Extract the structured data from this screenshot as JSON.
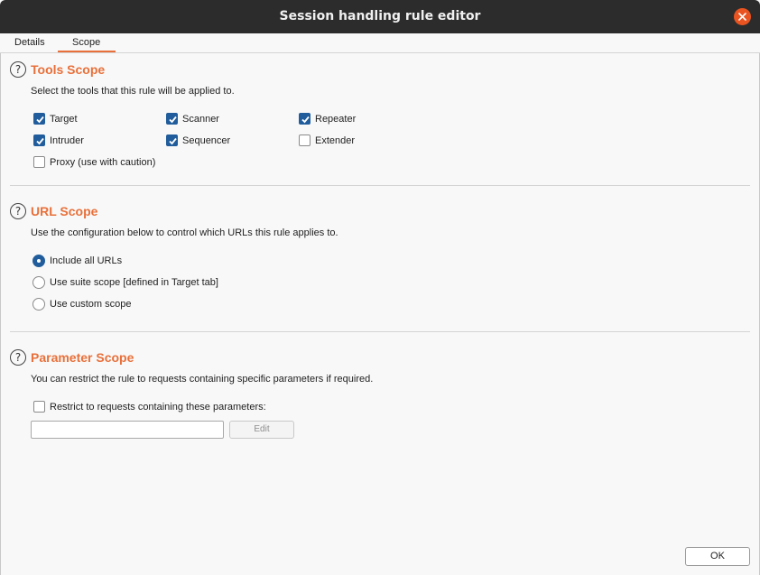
{
  "window": {
    "title": "Session handling rule editor"
  },
  "tabs": [
    {
      "label": "Details",
      "active": false
    },
    {
      "label": "Scope",
      "active": true
    }
  ],
  "colors": {
    "accent": "#e8703a",
    "checkbox": "#215d9c",
    "close": "#e95420"
  },
  "tools_scope": {
    "title": "Tools Scope",
    "description": "Select the tools that this rule will be applied to.",
    "tools": [
      {
        "label": "Target",
        "checked": true
      },
      {
        "label": "Scanner",
        "checked": true
      },
      {
        "label": "Repeater",
        "checked": true
      },
      {
        "label": "Intruder",
        "checked": true
      },
      {
        "label": "Sequencer",
        "checked": true
      },
      {
        "label": "Extender",
        "checked": false
      },
      {
        "label": "Proxy (use with caution)",
        "checked": false
      }
    ]
  },
  "url_scope": {
    "title": "URL Scope",
    "description": "Use the configuration below to control which URLs this rule applies to.",
    "options": [
      {
        "label": "Include all URLs",
        "selected": true
      },
      {
        "label": "Use suite scope [defined in Target tab]",
        "selected": false
      },
      {
        "label": "Use custom scope",
        "selected": false
      }
    ]
  },
  "parameter_scope": {
    "title": "Parameter Scope",
    "description": "You can restrict the rule to requests containing specific parameters if required.",
    "restrict_label": "Restrict to requests containing these parameters:",
    "restrict_checked": false,
    "parameters_value": "",
    "edit_label": "Edit"
  },
  "footer": {
    "ok_label": "OK"
  },
  "icons": {
    "close": "close-icon",
    "help": "help-icon",
    "check": "check-icon"
  }
}
